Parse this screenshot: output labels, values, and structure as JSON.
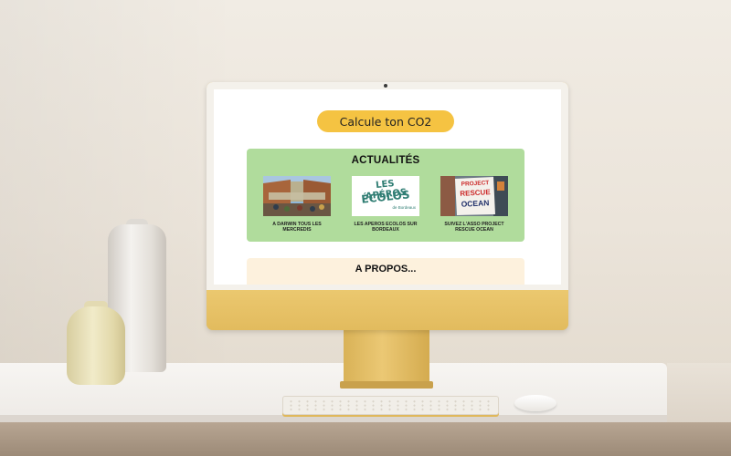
{
  "screen": {
    "cta_label": "Calcule ton CO2",
    "news": {
      "title": "ACTUALITÉS",
      "cards": [
        {
          "caption": "A DARWIN TOUS LES MERCREDIS",
          "image": "darwin-terrace-photo"
        },
        {
          "caption": "LES APEROS ECOLOS SUR BORDEAUX",
          "image": "aperos-ecolos-logo",
          "logo_line1": "LES APÉROS",
          "logo_line2": "ÉCOLOS",
          "logo_line3": "de Bordeaux"
        },
        {
          "caption": "SUIVEZ L'ASSO PROJECT RESCUE OCEAN",
          "image": "project-rescue-ocean-sign",
          "sign_line1": "PROJECT",
          "sign_line2": "RESCUE",
          "sign_line3": "OCEAN"
        }
      ]
    },
    "about": {
      "title": "A PROPOS..."
    }
  },
  "colors": {
    "cta": "#f5c342",
    "news_bg": "#b0dc9c",
    "about_bg": "#fdf1dd",
    "monitor": "#e7c56e"
  }
}
